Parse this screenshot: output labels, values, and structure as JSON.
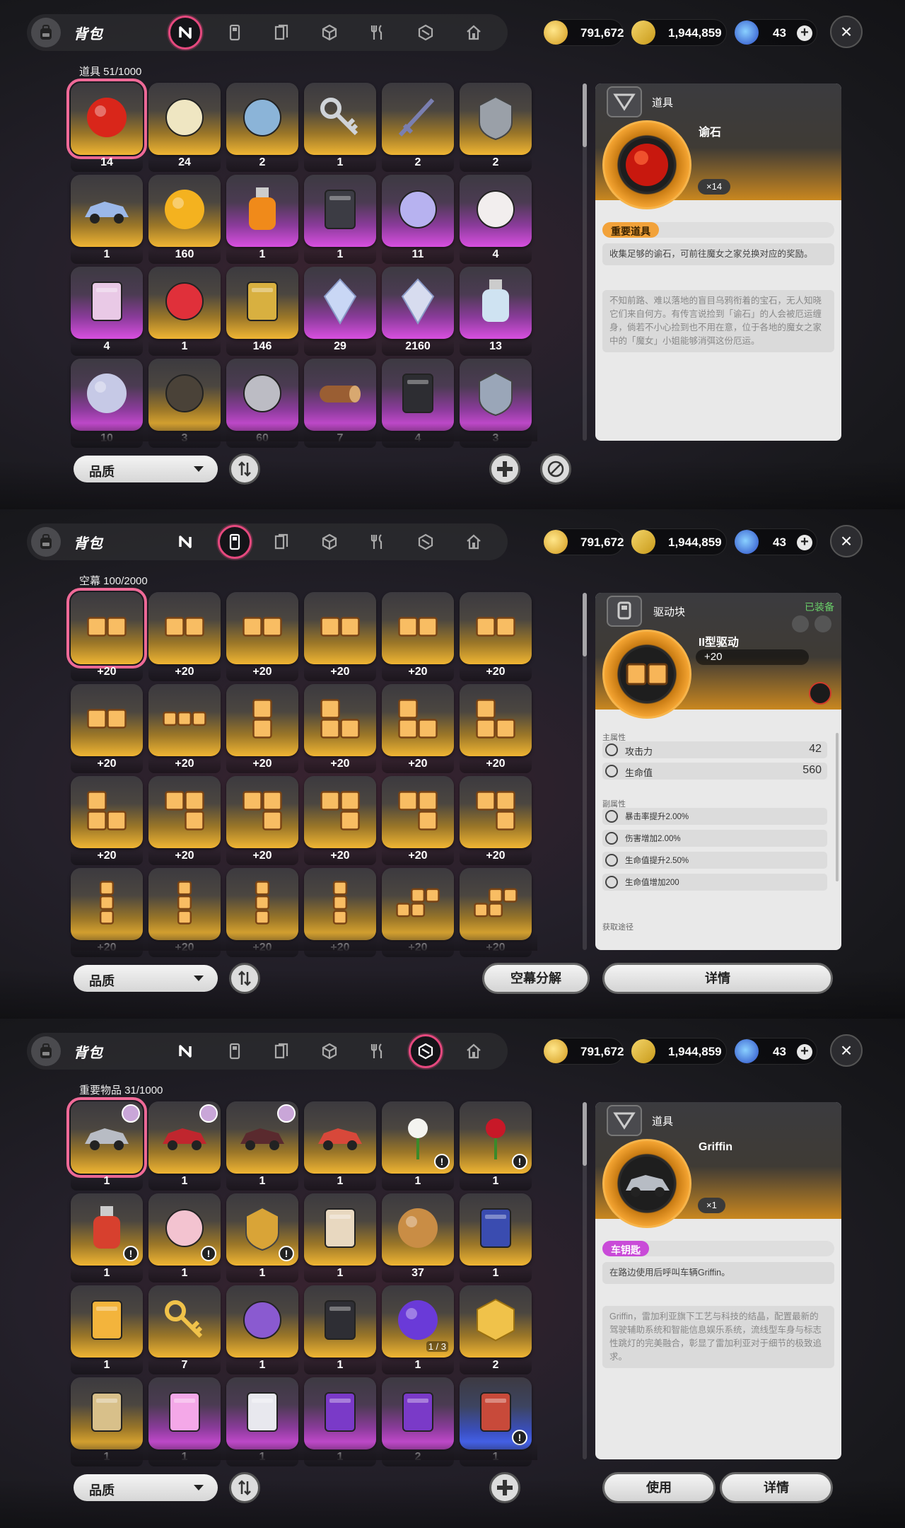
{
  "common": {
    "bag_title": "背包",
    "quality_label": "品质",
    "close_label": "×",
    "currency": {
      "gold": "791,672",
      "ticket": "1,944,859",
      "gem": "43",
      "plus": "+"
    }
  },
  "panel1": {
    "section_label": "道具 51/1000",
    "items": [
      {
        "count": "14",
        "bg": "gold",
        "icon": "red-orb-icon",
        "color": "#d9261a"
      },
      {
        "count": "24",
        "bg": "gold",
        "icon": "chess-piece-icon",
        "color": "#efe6c2"
      },
      {
        "count": "2",
        "bg": "gold",
        "icon": "thread-spool-icon",
        "color": "#8bb4d8"
      },
      {
        "count": "1",
        "bg": "gold",
        "icon": "key-icon",
        "color": "#cfd3d8"
      },
      {
        "count": "2",
        "bg": "gold",
        "icon": "sword-icon",
        "color": "#7a7fb0"
      },
      {
        "count": "2",
        "bg": "gold",
        "icon": "armor-icon",
        "color": "#9aa0a8"
      },
      {
        "count": "1",
        "bg": "gold",
        "icon": "ship-icon",
        "color": "#9bb8e8"
      },
      {
        "count": "160",
        "bg": "gold",
        "icon": "coin-icon",
        "color": "#f4b21f"
      },
      {
        "count": "1",
        "bg": "purple",
        "icon": "fire-bottle-icon",
        "color": "#f08a1a"
      },
      {
        "count": "1",
        "bg": "purple",
        "icon": "dark-book-icon",
        "color": "#3c3c44"
      },
      {
        "count": "11",
        "bg": "purple",
        "icon": "guitar-pick-icon",
        "color": "#b7b2f0"
      },
      {
        "count": "4",
        "bg": "purple",
        "icon": "mask-icon",
        "color": "#f2eeee"
      },
      {
        "count": "4",
        "bg": "purple",
        "icon": "ticket-icon",
        "color": "#e9c9e6"
      },
      {
        "count": "1",
        "bg": "gold",
        "icon": "red-creature-icon",
        "color": "#e0303a"
      },
      {
        "count": "146",
        "bg": "gold",
        "icon": "gold-card-icon",
        "color": "#d8b040"
      },
      {
        "count": "29",
        "bg": "purple",
        "icon": "crystal-cluster-icon",
        "color": "#c9d7f5"
      },
      {
        "count": "2160",
        "bg": "purple",
        "icon": "crystal-tower-icon",
        "color": "#d7dcef"
      },
      {
        "count": "13",
        "bg": "purple",
        "icon": "potion-bottle-icon",
        "color": "#cfe3f2"
      },
      {
        "count": "10",
        "bg": "purple",
        "icon": "disc-icon",
        "color": "#c6c9e6"
      },
      {
        "count": "3",
        "bg": "gold",
        "icon": "seed-icon",
        "color": "#4a4238"
      },
      {
        "count": "60",
        "bg": "purple",
        "icon": "coil-icon",
        "color": "#bcbcc4"
      },
      {
        "count": "7",
        "bg": "purple",
        "icon": "log-icon",
        "color": "#9a5e33"
      },
      {
        "count": "4",
        "bg": "purple",
        "icon": "black-block-icon",
        "color": "#2d2d32"
      },
      {
        "count": "3",
        "bg": "purple",
        "icon": "mech-armor-icon",
        "color": "#9aa6b8"
      }
    ],
    "detail": {
      "category": "道具",
      "name": "谕石",
      "qty": "×14",
      "tag": "重要道具",
      "desc1": "收集足够的谕石，可前往魔女之家兑换对应的奖励。",
      "desc2": "不知前路、难以落地的盲目乌鸦衔着的宝石，无人知晓它们来自何方。有传言说捡到「谕石」的人会被厄运缠身，倘若不小心捡到也不用在意，位于各地的魔女之家中的「魔女」小姐能够消弭这份厄运。"
    }
  },
  "panel2": {
    "section_label": "空幕 100/2000",
    "item_count": "+20",
    "shapes": [
      "h2",
      "h2",
      "h2",
      "h2",
      "h2",
      "h2",
      "h2",
      "h3",
      "v2",
      "L",
      "L",
      "L",
      "L",
      "J",
      "J",
      "J",
      "J",
      "J",
      "v3",
      "v3",
      "v3",
      "v3",
      "S",
      "S"
    ],
    "detail": {
      "category": "驱动块",
      "equipped": "已装备",
      "name": "II型驱动",
      "level": "+20",
      "main_label": "主属性",
      "sub_label": "副属性",
      "source_label": "获取途径",
      "main_stats": [
        {
          "name": "攻击力",
          "value": "42",
          "icon": "attack-icon"
        },
        {
          "name": "生命值",
          "value": "560",
          "icon": "heart-icon"
        }
      ],
      "sub_stats": [
        {
          "name": "暴击率提升2.00%",
          "icon": "crit-icon"
        },
        {
          "name": "伤害增加2.00%",
          "icon": "damage-icon"
        },
        {
          "name": "生命值提升2.50%",
          "icon": "heart-icon"
        },
        {
          "name": "生命值增加200",
          "icon": "heart-icon"
        }
      ],
      "decompose_label": "空幕分解",
      "details_label": "详情"
    }
  },
  "panel3": {
    "section_label": "重要物品 31/1000",
    "items": [
      {
        "count": "1",
        "bg": "gold",
        "icon": "silver-car-icon",
        "color": "#b8bcc4",
        "avatar": true
      },
      {
        "count": "1",
        "bg": "gold",
        "icon": "red-car-icon",
        "color": "#c0262e",
        "avatar": true
      },
      {
        "count": "1",
        "bg": "gold",
        "icon": "motorcycle-icon",
        "color": "#5a2a2e",
        "avatar": true
      },
      {
        "count": "1",
        "bg": "gold",
        "icon": "scooter-icon",
        "color": "#d8483a"
      },
      {
        "count": "1",
        "bg": "gold",
        "icon": "flower-icon",
        "color": "#f4f4f0",
        "warn": true
      },
      {
        "count": "1",
        "bg": "gold",
        "icon": "rose-icon",
        "color": "#c81828",
        "warn": true
      },
      {
        "count": "1",
        "bg": "gold",
        "icon": "pouch-icon",
        "color": "#d7402e",
        "warn": true
      },
      {
        "count": "1",
        "bg": "gold",
        "icon": "ice-cream-icon",
        "color": "#f3c3d0",
        "warn": true
      },
      {
        "count": "1",
        "bg": "gold",
        "icon": "helmet-icon",
        "color": "#d9a437",
        "warn": true
      },
      {
        "count": "1",
        "bg": "gold",
        "icon": "notebook-icon",
        "color": "#e8d8c0"
      },
      {
        "count": "37",
        "bg": "gold",
        "icon": "medal-coin-icon",
        "color": "#c98d45"
      },
      {
        "count": "1",
        "bg": "gold",
        "icon": "portal-card-icon",
        "color": "#3a4cb0"
      },
      {
        "count": "1",
        "bg": "gold",
        "icon": "glowing-card-icon",
        "color": "#f3b43c"
      },
      {
        "count": "7",
        "bg": "gold",
        "icon": "golden-key-icon",
        "color": "#f0c24a"
      },
      {
        "count": "1",
        "bg": "gold",
        "icon": "music-player-icon",
        "color": "#8a5ad0"
      },
      {
        "count": "1",
        "bg": "gold",
        "icon": "skull-card-icon",
        "color": "#2e2e34"
      },
      {
        "count": "1",
        "bg": "gold",
        "icon": "purple-orb-icon",
        "color": "#6a3ad8",
        "frac": "1 / 3"
      },
      {
        "count": "2",
        "bg": "gold",
        "icon": "gold-cube-icon",
        "color": "#f0c24a"
      },
      {
        "count": "1",
        "bg": "gold",
        "icon": "tag-card-icon",
        "color": "#d8c08a"
      },
      {
        "count": "1",
        "bg": "purple",
        "icon": "pink-card-icon",
        "color": "#f4a8e8"
      },
      {
        "count": "1",
        "bg": "purple",
        "icon": "white-card-icon",
        "color": "#e8e8ee"
      },
      {
        "count": "1",
        "bg": "purple",
        "icon": "violet-card-icon",
        "color": "#7a3ac8"
      },
      {
        "count": "2",
        "bg": "purple",
        "icon": "violet-card-icon",
        "color": "#7a3ac8"
      },
      {
        "count": "1",
        "bg": "blue",
        "icon": "character-card-icon",
        "color": "#c84a3a",
        "warn": true
      }
    ],
    "detail": {
      "category": "道具",
      "name": "Griffin",
      "qty": "×1",
      "tag": "车钥匙",
      "desc1": "在路边使用后呼叫车辆Griffin。",
      "desc2": "Griffin，雷加利亚旗下工艺与科技的结晶，配置最新的驾驶辅助系统和智能信息娱乐系统，流线型车身与标志性跳灯的完美融合，彰显了雷加利亚对于细节的极致追求。",
      "use_label": "使用",
      "details_label": "详情"
    }
  }
}
